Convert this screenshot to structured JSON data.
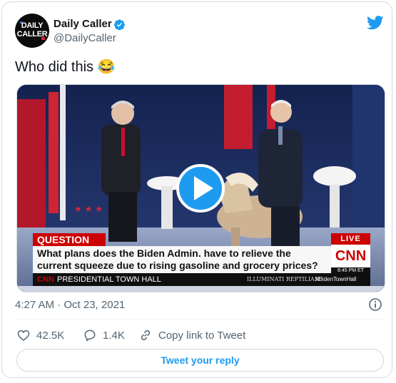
{
  "author": {
    "display_name": "Daily Caller",
    "handle": "@DailyCaller",
    "logo_line1": "DAILY",
    "logo_line2": "CALLER"
  },
  "tweet": {
    "text": "Who did this 😂"
  },
  "media": {
    "lower_third_tag": "QUESTION",
    "question_line1": "What plans does the Biden Admin. have to relieve the",
    "question_line2": "current squeeze due to rising gasoline and grocery prices?",
    "live_label": "LIVE",
    "network": "CNN",
    "time": "8:45 PM ET",
    "program_network": "CNN",
    "program": "PRESIDENTIAL TOWN HALL",
    "watermark": "ILLUMINATI  REPTILIAN",
    "hashtag": "#BidenTownHall"
  },
  "meta": {
    "timestamp": "4:27 AM · Oct 23, 2021"
  },
  "actions": {
    "likes": "42.5K",
    "replies": "1.4K",
    "copy_link": "Copy link to Tweet",
    "reply_button": "Tweet your reply"
  },
  "colors": {
    "twitter_blue": "#1d9bf0",
    "cnn_red": "#cc0000"
  },
  "icons": [
    "verified-badge-icon",
    "twitter-bird-icon",
    "play-icon",
    "info-icon",
    "heart-icon",
    "reply-icon",
    "link-icon"
  ]
}
